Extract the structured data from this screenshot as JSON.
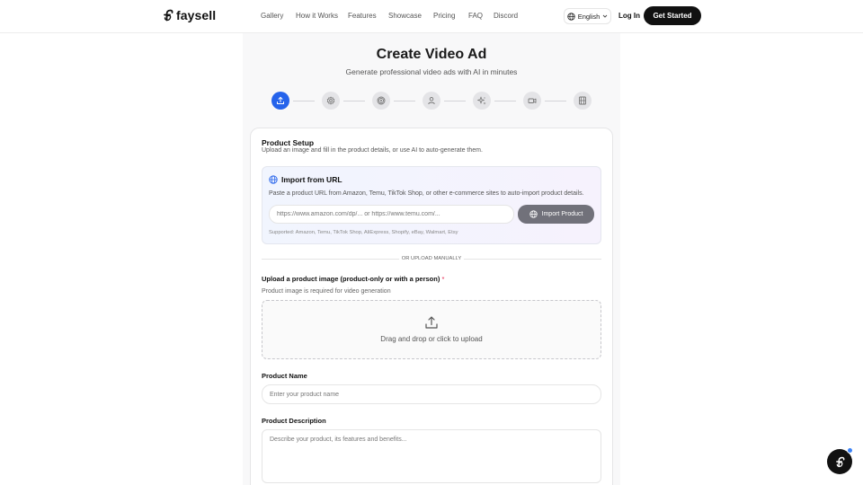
{
  "nav": {
    "brand": "faysell",
    "links": [
      "Gallery",
      "How it Works",
      "Features",
      "Showcase",
      "Pricing",
      "FAQ",
      "Discord"
    ],
    "language": "English",
    "login": "Log In",
    "cta": "Get Started"
  },
  "header": {
    "title": "Create Video Ad",
    "subtitle": "Generate professional video ads with AI in minutes"
  },
  "stepper": {
    "active_step": 1,
    "steps": [
      "upload-icon",
      "settings-icon",
      "target-icon",
      "user-icon",
      "sparkles-icon",
      "video-icon",
      "film-icon"
    ]
  },
  "product_setup": {
    "title": "Product Setup",
    "subtitle": "Upload an image and fill in the product details, or use AI to auto-generate them.",
    "import": {
      "title": "Import from URL",
      "description": "Paste a product URL from Amazon, Temu, TikTok Shop, or other e-commerce sites to auto-import product details.",
      "placeholder": "https://www.amazon.com/dp/... or https://www.temu.com/...",
      "button": "Import Product",
      "supported": "Supported: Amazon, Temu, TikTok Shop, AliExpress, Shopify, eBay, Walmart, Etsy"
    },
    "divider": "OR UPLOAD MANUALLY",
    "upload": {
      "label": "Upload a product image (product-only or with a person)",
      "required_mark": "*",
      "hint": "Product image is required for video generation",
      "drop_text": "Drag and drop or click to upload"
    },
    "product_name": {
      "label": "Product Name",
      "placeholder": "Enter your product name"
    },
    "product_description": {
      "label": "Product Description",
      "placeholder": "Describe your product, its features and benefits..."
    }
  },
  "colors": {
    "accent": "#2563eb",
    "primary_dark": "#111111",
    "import_button": "#71717a"
  }
}
